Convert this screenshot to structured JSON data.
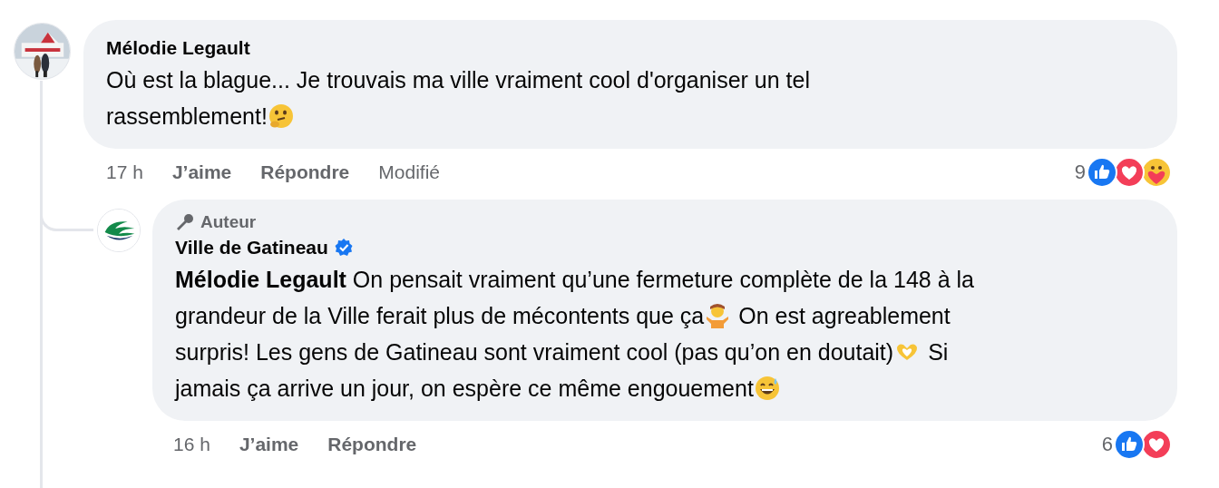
{
  "comment": {
    "author": "Mélodie Legault",
    "avatar": {
      "kind": "picture"
    },
    "lines": [
      [
        {
          "kind": "text",
          "text": "Où est la blague... Je trouvais ma ville vraiment cool d'organiser un tel"
        }
      ],
      [
        {
          "kind": "text",
          "text": "rassemblement!"
        },
        {
          "kind": "thinking"
        }
      ]
    ],
    "time": "17 h",
    "actions": [
      "J’aime",
      "Répondre"
    ],
    "edited": "Modifié",
    "reactions": {
      "count": "9",
      "types": [
        {
          "kind": "like"
        },
        {
          "kind": "love"
        },
        {
          "kind": "care"
        }
      ]
    },
    "replies": [
      {
        "badge": "Auteur",
        "author": "Ville de Gatineau",
        "verified": true,
        "lines": [
          [
            {
              "kind": "mention",
              "text": "Mélodie Legault"
            },
            {
              "kind": "text",
              "text": " On pensait vraiment qu’une fermeture complète de la 148 à la"
            }
          ],
          [
            {
              "kind": "text",
              "text": "grandeur de la Ville ferait plus de mécontents que ça"
            },
            {
              "kind": "shrug"
            },
            {
              "kind": "text",
              "text": "On est agreablement"
            }
          ],
          [
            {
              "kind": "text",
              "text": "surpris! Les gens de Gatineau sont vraiment cool (pas qu’on en doutait)"
            },
            {
              "kind": "hearthands"
            },
            {
              "kind": "text",
              "text": "Si"
            }
          ],
          [
            {
              "kind": "text",
              "text": "jamais ça arrive un jour, on espère ce même engouement"
            },
            {
              "kind": "sweat"
            }
          ]
        ],
        "time": "16 h",
        "actions": [
          "J’aime",
          "Répondre"
        ],
        "reactions": {
          "count": "6",
          "types": [
            {
              "kind": "like"
            },
            {
              "kind": "love"
            }
          ]
        }
      }
    ]
  }
}
